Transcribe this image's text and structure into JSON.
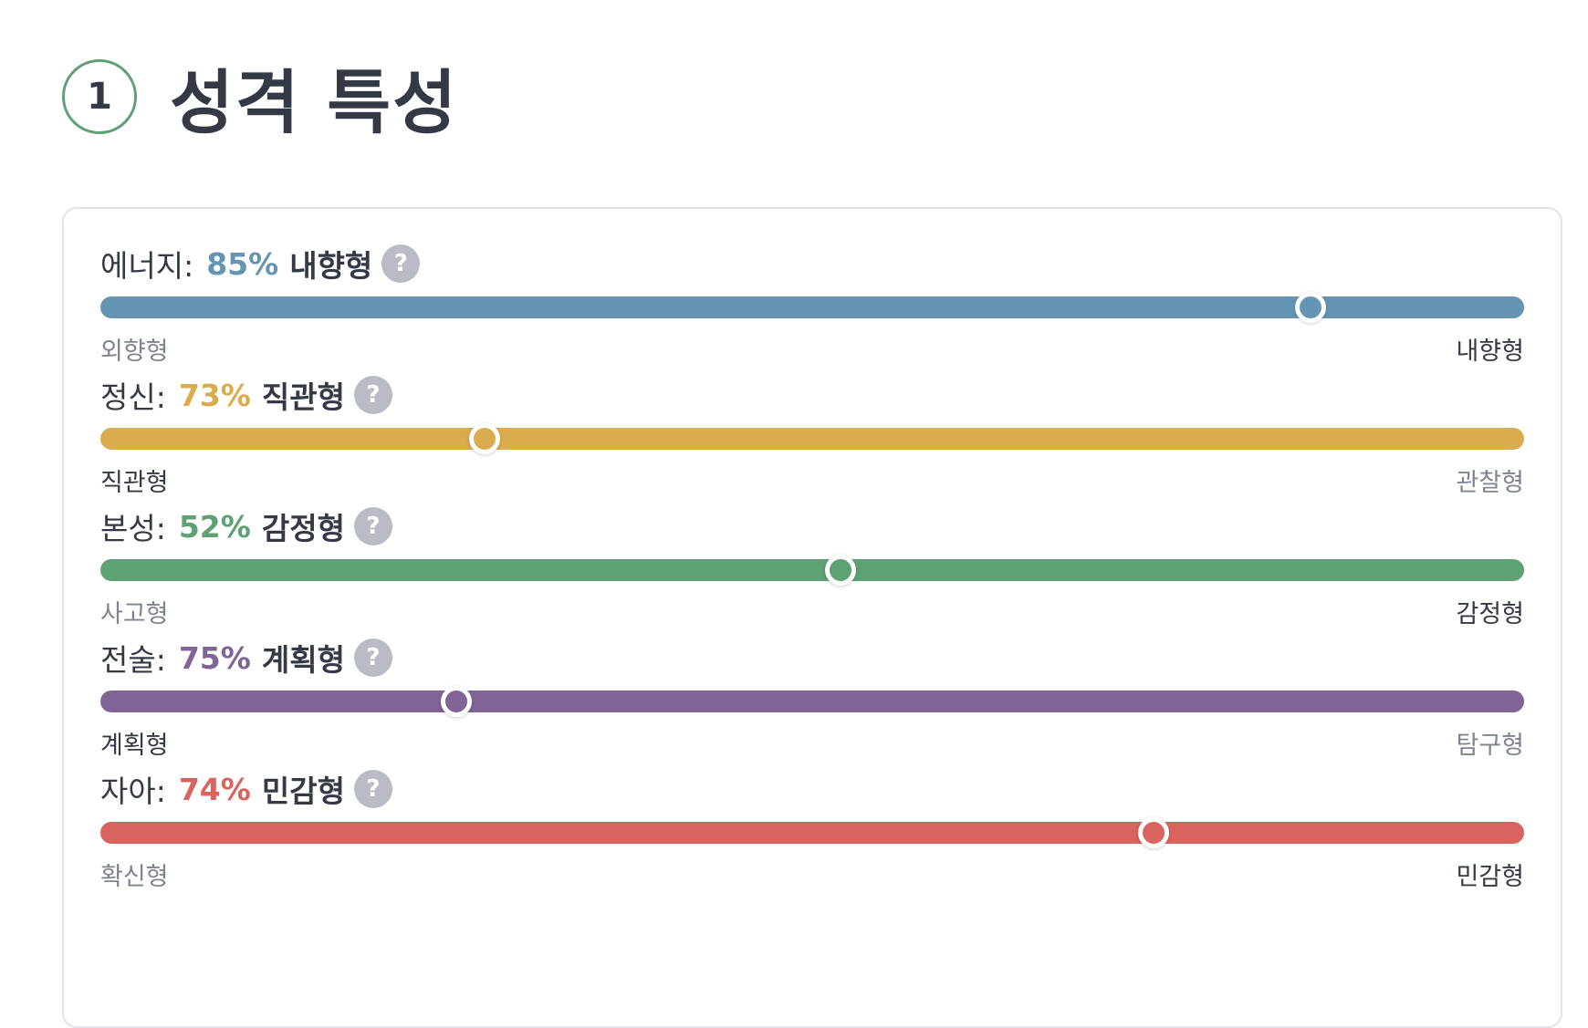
{
  "section": {
    "number": "1",
    "title": "성격 특성"
  },
  "help_glyph": "?",
  "traits": [
    {
      "name": "에너지:",
      "percent": "85%",
      "result": "내향형",
      "left_label": "외향형",
      "right_label": "내향형",
      "position": 0.85,
      "highlight": "right",
      "color": "#6496b3"
    },
    {
      "name": "정신:",
      "percent": "73%",
      "result": "직관형",
      "left_label": "직관형",
      "right_label": "관찰형",
      "position": 0.27,
      "highlight": "left",
      "color": "#d9ad4e"
    },
    {
      "name": "본성:",
      "percent": "52%",
      "result": "감정형",
      "left_label": "사고형",
      "right_label": "감정형",
      "position": 0.52,
      "highlight": "right",
      "color": "#5ea174"
    },
    {
      "name": "전술:",
      "percent": "75%",
      "result": "계획형",
      "left_label": "계획형",
      "right_label": "탐구형",
      "position": 0.25,
      "highlight": "left",
      "color": "#816496"
    },
    {
      "name": "자아:",
      "percent": "74%",
      "result": "민감형",
      "left_label": "확신형",
      "right_label": "민감형",
      "position": 0.74,
      "highlight": "right",
      "color": "#d9645f"
    }
  ]
}
